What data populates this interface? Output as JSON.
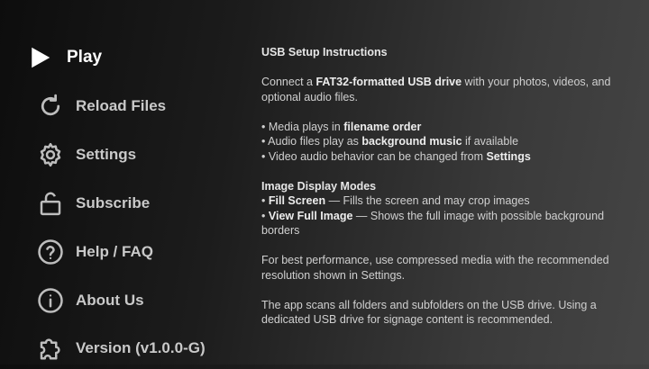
{
  "menu": {
    "items": [
      {
        "label": "Play",
        "icon": "play-icon"
      },
      {
        "label": "Reload Files",
        "icon": "reload-icon"
      },
      {
        "label": "Settings",
        "icon": "gear-icon"
      },
      {
        "label": "Subscribe",
        "icon": "unlock-icon"
      },
      {
        "label": "Help / FAQ",
        "icon": "help-icon"
      },
      {
        "label": "About Us",
        "icon": "info-icon"
      },
      {
        "label": "Version (v1.0.0-G)",
        "icon": "puzzle-icon"
      }
    ]
  },
  "instructions": {
    "title": "USB Setup Instructions",
    "intro_pre": "Connect a ",
    "intro_bold": "FAT32-formatted USB drive",
    "intro_post": " with your photos, videos, and optional audio files.",
    "bullet1_pre": "• Media plays in ",
    "bullet1_bold": "filename order",
    "bullet2_pre": "• Audio files play as ",
    "bullet2_bold": "background music",
    "bullet2_post": " if available",
    "bullet3_pre": "• Video audio behavior can be changed from ",
    "bullet3_bold": "Settings",
    "modes_title": "Image Display Modes",
    "mode1_bold": "Fill Screen",
    "mode1_post": " — Fills the screen and may crop images",
    "mode2_bold": "View Full Image",
    "mode2_post": " — Shows the full image with possible background borders",
    "performance": "For best performance, use compressed media with the recommended resolution shown in Settings.",
    "scan": "The app scans all folders and subfolders on the USB drive. Using a dedicated USB drive for signage content is recommended."
  }
}
